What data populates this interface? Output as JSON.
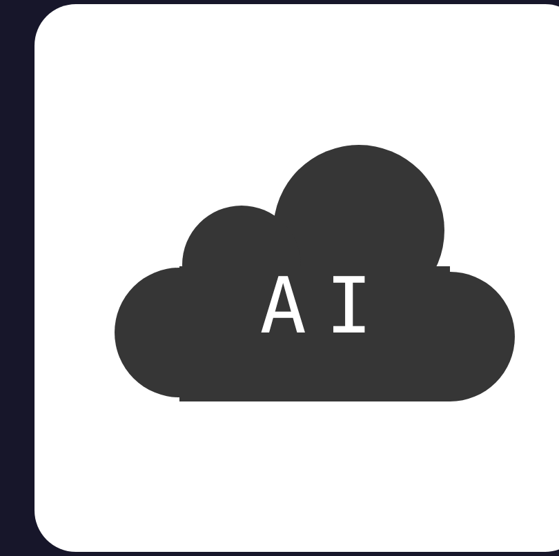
{
  "logo": {
    "text": "AI"
  }
}
